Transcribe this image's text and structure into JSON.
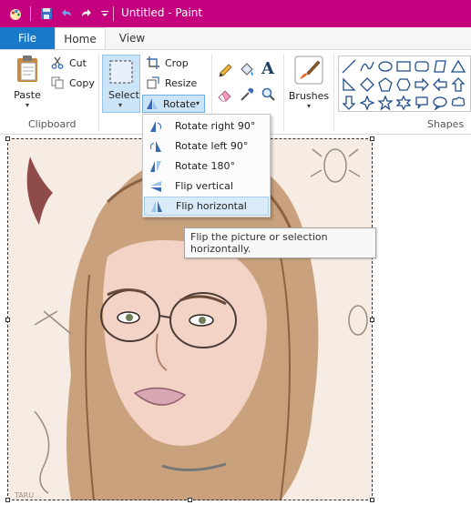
{
  "window": {
    "title": "Untitled - Paint"
  },
  "tabs": {
    "file": "File",
    "home": "Home",
    "view": "View"
  },
  "ribbon": {
    "clipboard": {
      "paste": "Paste",
      "cut": "Cut",
      "copy": "Copy",
      "label": "Clipboard"
    },
    "image": {
      "select": "Select",
      "crop": "Crop",
      "resize": "Resize",
      "rotate": "Rotate",
      "label": "I"
    },
    "tools": {
      "pencil": "pencil-icon",
      "fill": "fill-icon",
      "text": "A"
    },
    "brushes": {
      "label": "Brushes"
    },
    "shapes": {
      "label": "Shapes"
    }
  },
  "rotate_menu": {
    "items": [
      "Rotate right 90°",
      "Rotate left 90°",
      "Rotate 180°",
      "Flip vertical",
      "Flip horizontal"
    ],
    "highlighted_index": 4
  },
  "tooltip": {
    "line1": "Flip the picture or selection",
    "line2": "horizontally."
  },
  "canvas": {
    "signature": "TARU"
  },
  "colors": {
    "titlebar": "#c5007f",
    "file_tab": "#1979ca",
    "highlight": "#cce4f7"
  }
}
